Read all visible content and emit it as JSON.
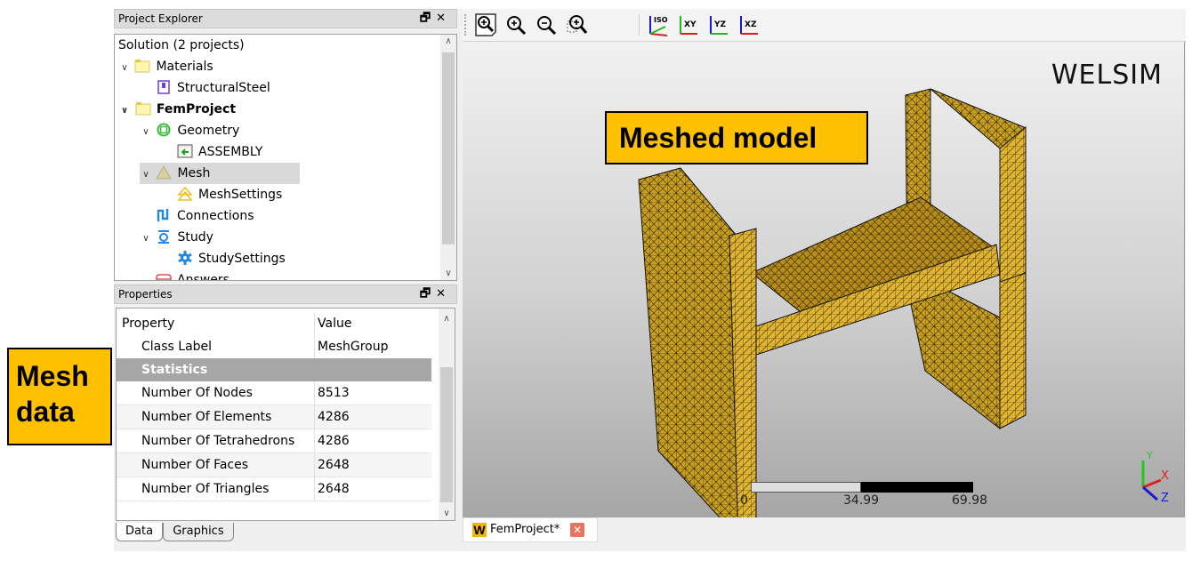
{
  "project_explorer": {
    "title": "Project Explorer",
    "float_icon": "float-icon",
    "close_icon": "close-icon",
    "items": [
      {
        "label": "Solution (2 projects)",
        "icon": "none",
        "level": 0
      },
      {
        "label": "Materials",
        "icon": "folder-icon",
        "level": 0,
        "expanded": true
      },
      {
        "label": "StructuralSteel",
        "icon": "material-icon",
        "level": 1
      },
      {
        "label": "FemProject",
        "icon": "folder-icon",
        "level": 0,
        "expanded": true,
        "bold": true
      },
      {
        "label": "Geometry",
        "icon": "geometry-icon",
        "level": 1,
        "expanded": true
      },
      {
        "label": "ASSEMBLY",
        "icon": "assembly-icon",
        "level": 2
      },
      {
        "label": "Mesh",
        "icon": "mesh-icon",
        "level": 1,
        "expanded": true,
        "selected": true
      },
      {
        "label": "MeshSettings",
        "icon": "mesh-settings-icon",
        "level": 2
      },
      {
        "label": "Connections",
        "icon": "connections-icon",
        "level": 1
      },
      {
        "label": "Study",
        "icon": "study-icon",
        "level": 1,
        "expanded": true
      },
      {
        "label": "StudySettings",
        "icon": "gear-icon",
        "level": 2
      },
      {
        "label": "Answers",
        "icon": "answers-icon",
        "level": 1
      }
    ]
  },
  "properties": {
    "title": "Properties",
    "header": {
      "property": "Property",
      "value": "Value"
    },
    "rows": [
      {
        "key": "Class Label",
        "value": "MeshGroup"
      },
      {
        "key": "Statistics",
        "value": "",
        "group": true
      },
      {
        "key": "Number Of Nodes",
        "value": "8513"
      },
      {
        "key": "Number Of Elements",
        "value": "4286"
      },
      {
        "key": "Number Of Tetrahedrons",
        "value": "4286"
      },
      {
        "key": "Number Of Faces",
        "value": "2648"
      },
      {
        "key": "Number Of Triangles",
        "value": "2648"
      }
    ]
  },
  "bottom_tabs": [
    "Data",
    "Graphics"
  ],
  "toolbar": {
    "buttons": [
      "zoom-fit-icon",
      "zoom-in-icon",
      "zoom-out-icon",
      "zoom-box-icon",
      "view-iso-icon",
      "view-xy-icon",
      "view-yz-icon",
      "view-xz-icon"
    ],
    "view_labels": {
      "iso": "ISO",
      "xy": "XY",
      "yz": "YZ",
      "xz": "XZ"
    }
  },
  "viewport": {
    "brand": "WELSIM",
    "scale_bar": {
      "labels": [
        "0",
        "34.99",
        "69.98"
      ]
    },
    "axes": {
      "x": "X",
      "y": "Y",
      "z": "Z"
    },
    "mesh_color": "#d4a017"
  },
  "annotations": {
    "meshed_model": "Meshed model",
    "mesh_data_line1": "Mesh",
    "mesh_data_line2": "data",
    "color": "#ffc000"
  },
  "doc_tab": {
    "label": "FemProject*",
    "logo": "W"
  }
}
